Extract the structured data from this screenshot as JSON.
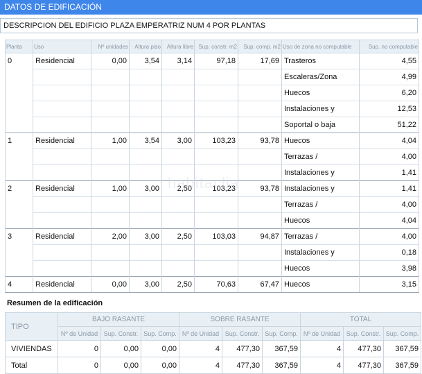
{
  "header": {
    "title": "DATOS DE EDIFICACIÓN"
  },
  "description": "DESCRIPCION DEL EDIFICIO PLAZA EMPERATRIZ NUM 4 POR PLANTAS",
  "floors_table": {
    "headers": [
      "Planta",
      "Uso",
      "Nº unidades",
      "Altura piso",
      "Altura libre",
      "Sup. constr. m2",
      "Sup. comp. m2",
      "Uso de zona no computable",
      "Sup. no computable"
    ],
    "rows": [
      {
        "planta": "0",
        "uso": "Residencial",
        "unidades": "0,00",
        "altura_piso": "3,54",
        "altura_libre": "3,14",
        "sup_constr": "97,18",
        "sup_comp": "17,69",
        "zona": "Trasteros",
        "sup_no_comp": "4,55"
      },
      {
        "planta": "",
        "uso": "",
        "unidades": "",
        "altura_piso": "",
        "altura_libre": "",
        "sup_constr": "",
        "sup_comp": "",
        "zona": "Escaleras/Zona",
        "sup_no_comp": "4,99"
      },
      {
        "planta": "",
        "uso": "",
        "unidades": "",
        "altura_piso": "",
        "altura_libre": "",
        "sup_constr": "",
        "sup_comp": "",
        "zona": "Huecos",
        "sup_no_comp": "6,20"
      },
      {
        "planta": "",
        "uso": "",
        "unidades": "",
        "altura_piso": "",
        "altura_libre": "",
        "sup_constr": "",
        "sup_comp": "",
        "zona": "Instalaciones y",
        "sup_no_comp": "12,53"
      },
      {
        "planta": "",
        "uso": "",
        "unidades": "",
        "altura_piso": "",
        "altura_libre": "",
        "sup_constr": "",
        "sup_comp": "",
        "zona": "Soportal o baja",
        "sup_no_comp": "51,22"
      },
      {
        "planta": "1",
        "uso": "Residencial",
        "unidades": "1,00",
        "altura_piso": "3,54",
        "altura_libre": "3,00",
        "sup_constr": "103,23",
        "sup_comp": "93,78",
        "zona": "Huecos",
        "sup_no_comp": "4,04"
      },
      {
        "planta": "",
        "uso": "",
        "unidades": "",
        "altura_piso": "",
        "altura_libre": "",
        "sup_constr": "",
        "sup_comp": "",
        "zona": "Terrazas /",
        "sup_no_comp": "4,00"
      },
      {
        "planta": "",
        "uso": "",
        "unidades": "",
        "altura_piso": "",
        "altura_libre": "",
        "sup_constr": "",
        "sup_comp": "",
        "zona": "Instalaciones y",
        "sup_no_comp": "1,41"
      },
      {
        "planta": "2",
        "uso": "Residencial",
        "unidades": "1,00",
        "altura_piso": "3,00",
        "altura_libre": "2,50",
        "sup_constr": "103,23",
        "sup_comp": "93,78",
        "zona": "Instalaciones y",
        "sup_no_comp": "1,41"
      },
      {
        "planta": "",
        "uso": "",
        "unidades": "",
        "altura_piso": "",
        "altura_libre": "",
        "sup_constr": "",
        "sup_comp": "",
        "zona": "Terrazas /",
        "sup_no_comp": "4,00"
      },
      {
        "planta": "",
        "uso": "",
        "unidades": "",
        "altura_piso": "",
        "altura_libre": "",
        "sup_constr": "",
        "sup_comp": "",
        "zona": "Huecos",
        "sup_no_comp": "4,04"
      },
      {
        "planta": "3",
        "uso": "Residencial",
        "unidades": "2,00",
        "altura_piso": "3,00",
        "altura_libre": "2,50",
        "sup_constr": "103,03",
        "sup_comp": "94,87",
        "zona": "Terrazas /",
        "sup_no_comp": "4,00"
      },
      {
        "planta": "",
        "uso": "",
        "unidades": "",
        "altura_piso": "",
        "altura_libre": "",
        "sup_constr": "",
        "sup_comp": "",
        "zona": "Instalaciones y",
        "sup_no_comp": "0,18"
      },
      {
        "planta": "",
        "uso": "",
        "unidades": "",
        "altura_piso": "",
        "altura_libre": "",
        "sup_constr": "",
        "sup_comp": "",
        "zona": "Huecos",
        "sup_no_comp": "3,98"
      },
      {
        "planta": "4",
        "uso": "Residencial",
        "unidades": "0,00",
        "altura_piso": "3,00",
        "altura_libre": "2,50",
        "sup_constr": "70,63",
        "sup_comp": "67,47",
        "zona": "Huecos",
        "sup_no_comp": "3,15"
      }
    ]
  },
  "summary": {
    "title": "Resumen de la edificación",
    "tipo_header": "TIPO",
    "groups": [
      "BAJO RASANTE",
      "SOBRE RASANTE",
      "TOTAL"
    ],
    "subheaders": [
      "Nº de Unidad",
      "Sup. Constr.",
      "Sup. Comp."
    ],
    "rows": [
      {
        "tipo": "VIVIENDAS",
        "values": [
          "0",
          "0,00",
          "0,00",
          "4",
          "477,30",
          "367,59",
          "4",
          "477,30",
          "367,59"
        ]
      },
      {
        "tipo": "Total",
        "values": [
          "0",
          "0,00",
          "0,00",
          "4",
          "477,30",
          "367,59",
          "4",
          "477,30",
          "367,59"
        ]
      }
    ]
  }
}
